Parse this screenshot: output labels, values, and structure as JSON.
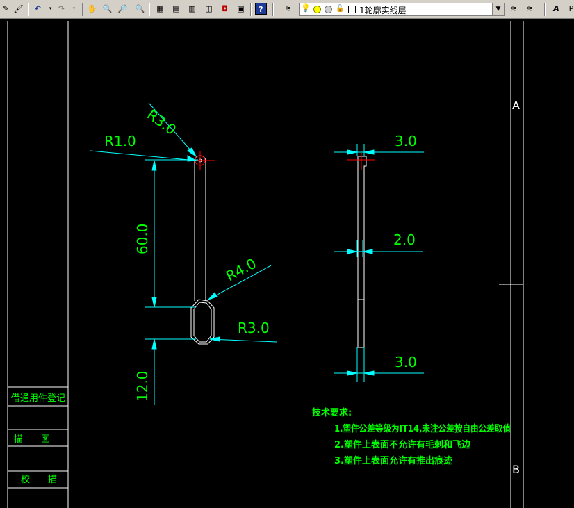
{
  "toolbar": {
    "layer_name": "1轮廓实线层",
    "right_cut_label": "P",
    "icons": [
      "pencil-icon",
      "match-properties-icon",
      "undo-icon",
      "redo-icon",
      "pan-icon",
      "zoom-realtime-icon",
      "zoom-window-icon",
      "zoom-previous-icon",
      "properties-icon",
      "design-center-icon",
      "tool-palette-icon",
      "markup-icon",
      "calculator-icon",
      "help-icon",
      "layer-manager-icon",
      "layer-previous-icon",
      "text-style-icon"
    ]
  },
  "title_block": {
    "row1": "借通用件登记",
    "row2": "描　　图",
    "row3": "校　　描"
  },
  "zone_labels": {
    "a": "A",
    "b": "B"
  },
  "front_view": {
    "r1": "R1.0",
    "r3_top": "R3.0",
    "length": "60.0",
    "r4": "R4.0",
    "r3_bottom": "R3.0",
    "bottom_length": "12.0"
  },
  "side_view": {
    "top_width": "3.0",
    "mid_width": "2.0",
    "bottom_width": "3.0"
  },
  "tech": {
    "heading": "技术要求:",
    "line1": "1.塑件公差等级为IT14,未注公差按自由公差取值",
    "line2": "2.塑件上表面不允许有毛刺和飞边",
    "line3": "3.塑件上表面允许有推出痕迹"
  },
  "colors": {
    "canvas": "#000000",
    "dimension": "#00ffff",
    "dim_text": "#00ff00",
    "outline": "#ffffff",
    "center": "#ff0000",
    "tech_text": "#00ff00"
  }
}
